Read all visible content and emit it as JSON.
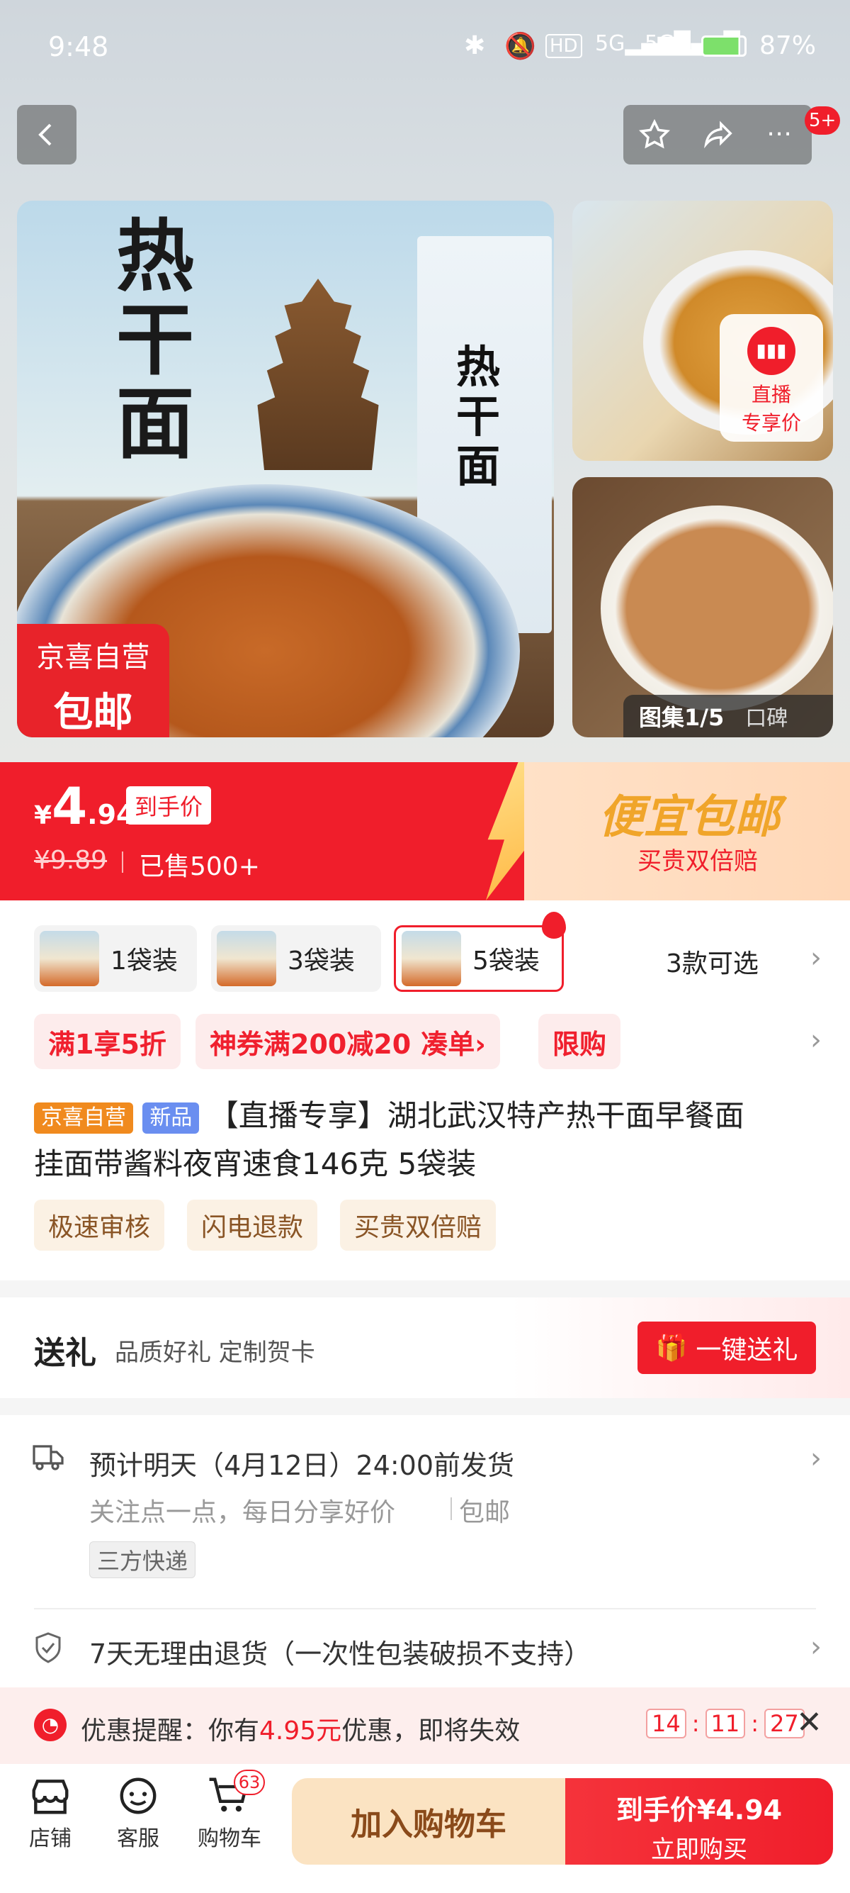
{
  "status": {
    "time": "9:48",
    "battery": "87%"
  },
  "nav": {
    "cart_badge": "5+"
  },
  "gallery": {
    "main_title": "热干面",
    "package_title": "热干面",
    "badge_line1": "京喜自营",
    "badge_line2": "包邮",
    "live_label_1": "直播",
    "live_label_2": "专享价",
    "album_counter": "图集1/5",
    "reviews_label": "口碑"
  },
  "price": {
    "currency": "¥",
    "integer": "4",
    "decimal": ".94",
    "final_tag": "到手价",
    "original": "¥9.89",
    "sold": "已售500+",
    "promo_title": "便宜包邮",
    "promo_sub": "买贵双倍赔"
  },
  "skus": {
    "items": [
      {
        "label": "1袋装"
      },
      {
        "label": "3袋装"
      },
      {
        "label": "5袋装"
      }
    ],
    "count_label": "3款可选"
  },
  "coupons": {
    "c1": "满1享5折",
    "c2": "神券满200减20",
    "c2_action": "凑单",
    "c3": "限购"
  },
  "product": {
    "tag_store": "京喜自营",
    "tag_new": "新品",
    "title_line1": "【直播专享】湖北武汉特产热干面早餐面",
    "title_line2": "挂面带酱料夜宵速食146克 5袋装",
    "service_tags": [
      "极速审核",
      "闪电退款",
      "买贵双倍赔"
    ]
  },
  "gift": {
    "title": "送礼",
    "desc": "品质好礼 定制贺卡",
    "button": "一键送礼"
  },
  "shipping": {
    "line1": "预计明天（4月12日）24:00前发货",
    "line2": "关注点一点，每日分享好价",
    "line2_extra": "包邮",
    "carrier": "三方快递"
  },
  "returns": {
    "text": "7天无理由退货（一次性包装破损不支持）"
  },
  "reminder": {
    "prefix": "优惠提醒：你有",
    "amount": "4.95元",
    "suffix": "优惠，即将失效",
    "timer": [
      "14",
      "11",
      "27"
    ]
  },
  "bottom": {
    "store": "店铺",
    "service": "客服",
    "cart": "购物车",
    "cart_count": "63",
    "add_cart": "加入购物车",
    "buy_price_label": "到手价¥4.94",
    "buy_now": "立即购买"
  },
  "colors": {
    "primary_red": "#f01e2b",
    "gold": "#ffcf4a",
    "cream": "#fbe3c2"
  }
}
